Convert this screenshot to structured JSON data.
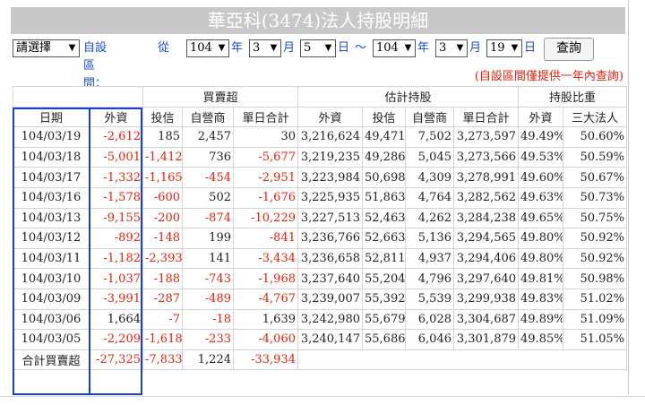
{
  "title": "華亞科(3474)法人持股明細",
  "filter": {
    "mode_select": "請選擇",
    "custom_range_label": "自設區間：",
    "from_label": "從",
    "start_year": "104",
    "year_label": "年",
    "start_month": "3",
    "month_label": "月",
    "start_day": "5",
    "day_label": "日",
    "tilde": "～",
    "end_year": "104",
    "end_month": "3",
    "end_day": "19",
    "query_button": "查詢"
  },
  "note": "(自設區間僅提供一年內查詢)",
  "table": {
    "group_headers": [
      "買賣超",
      "估計持股",
      "持股比重"
    ],
    "columns": [
      "日期",
      "外資",
      "投信",
      "自營商",
      "單日合計",
      "外資",
      "投信",
      "自營商",
      "單日合計",
      "外資",
      "三大法人"
    ],
    "rows": [
      [
        "104/03/19",
        "-2,612",
        "185",
        "2,457",
        "30",
        "3,216,624",
        "49,471",
        "7,502",
        "3,273,597",
        "49.49%",
        "50.60%"
      ],
      [
        "104/03/18",
        "-5,001",
        "-1,412",
        "736",
        "-5,677",
        "3,219,235",
        "49,286",
        "5,045",
        "3,273,566",
        "49.53%",
        "50.59%"
      ],
      [
        "104/03/17",
        "-1,332",
        "-1,165",
        "-454",
        "-2,951",
        "3,223,984",
        "50,698",
        "4,309",
        "3,278,991",
        "49.60%",
        "50.67%"
      ],
      [
        "104/03/16",
        "-1,578",
        "-600",
        "502",
        "-1,676",
        "3,225,935",
        "51,863",
        "4,764",
        "3,282,562",
        "49.63%",
        "50.73%"
      ],
      [
        "104/03/13",
        "-9,155",
        "-200",
        "-874",
        "-10,229",
        "3,227,513",
        "52,463",
        "4,262",
        "3,284,238",
        "49.65%",
        "50.75%"
      ],
      [
        "104/03/12",
        "-892",
        "-148",
        "199",
        "-841",
        "3,236,766",
        "52,663",
        "5,136",
        "3,294,565",
        "49.80%",
        "50.92%"
      ],
      [
        "104/03/11",
        "-1,182",
        "-2,393",
        "141",
        "-3,434",
        "3,236,658",
        "52,811",
        "4,937",
        "3,294,406",
        "49.80%",
        "50.92%"
      ],
      [
        "104/03/10",
        "-1,037",
        "-188",
        "-743",
        "-1,968",
        "3,237,640",
        "55,204",
        "4,796",
        "3,297,640",
        "49.81%",
        "50.98%"
      ],
      [
        "104/03/09",
        "-3,991",
        "-287",
        "-489",
        "-4,767",
        "3,239,007",
        "55,392",
        "5,539",
        "3,299,938",
        "49.83%",
        "51.02%"
      ],
      [
        "104/03/06",
        "1,664",
        "-7",
        "-18",
        "1,639",
        "3,242,980",
        "55,679",
        "6,028",
        "3,304,687",
        "49.89%",
        "51.09%"
      ],
      [
        "104/03/05",
        "-2,209",
        "-1,618",
        "-233",
        "-4,060",
        "3,240,147",
        "55,686",
        "6,046",
        "3,301,879",
        "49.85%",
        "51.05%"
      ]
    ],
    "total": [
      "合計買賣超",
      "-27,325",
      "-7,833",
      "1,224",
      "-33,934"
    ]
  },
  "colors": {
    "negative": "#e8200d",
    "highlight_border": "#1a3dd6",
    "title_bg": "#c8c8c8",
    "label_blue": "#1a4bd6"
  }
}
